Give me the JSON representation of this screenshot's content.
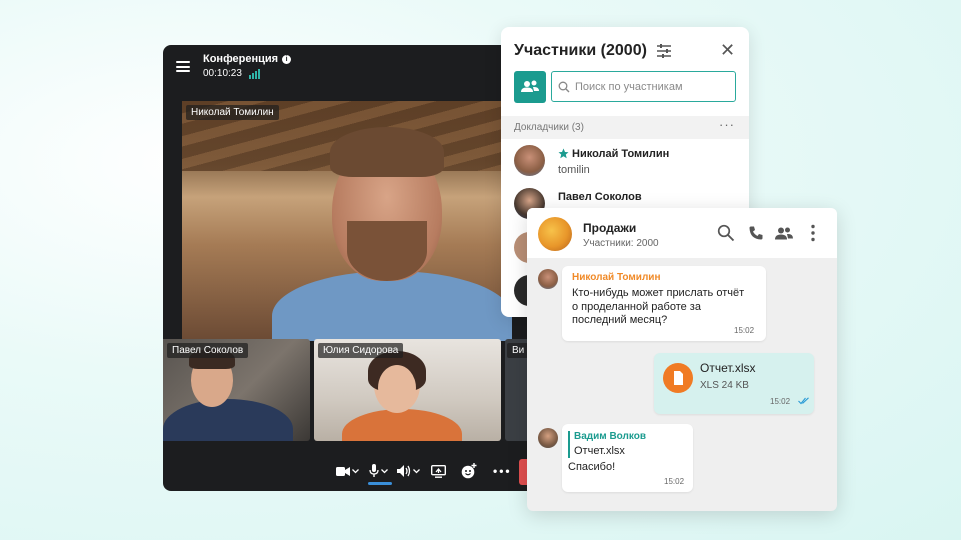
{
  "conference": {
    "title": "Конференция",
    "timer": "00:10:23",
    "main_speaker": "Николай Томилин",
    "thumbnails": [
      {
        "name": "Павел Соколов"
      },
      {
        "name": "Юлия Сидорова"
      },
      {
        "name": "Ви"
      }
    ],
    "icons": [
      "menu-icon",
      "info-icon",
      "signal-icon",
      "camera-icon",
      "microphone-icon",
      "speaker-icon",
      "screen-share-icon",
      "emoji-icon",
      "more-icon"
    ]
  },
  "participants": {
    "title": "Участники (2000)",
    "search_placeholder": "Поиск по участникам",
    "section_label": "Докладчики (3)",
    "more": "···",
    "list": [
      {
        "name": "Николай Томилин",
        "login": "tomilin",
        "starred": true
      },
      {
        "name": "Павел Соколов",
        "login": ""
      }
    ]
  },
  "chat": {
    "title": "Продажи",
    "subtitle": "Участники: 2000",
    "messages": [
      {
        "author": "Николай Томилин",
        "author_color": "#f08a28",
        "text_lines": [
          "Кто-нибудь может прислать отчёт",
          "о проделанной работе за",
          "последний месяц?"
        ],
        "time": "15:02"
      },
      {
        "file_name": "Отчет.xlsx",
        "file_meta": "XLS 24 KB",
        "time": "15:02",
        "outgoing": true
      },
      {
        "author": "Вадим Волков",
        "author_color": "#1b9b8f",
        "quote": "Отчет.xlsx",
        "text": "Спасибо!",
        "time": "15:02"
      }
    ]
  },
  "colors": {
    "accent": "#1b9b8f",
    "end_call": "#e04f4f",
    "file_orange": "#f07b24"
  }
}
